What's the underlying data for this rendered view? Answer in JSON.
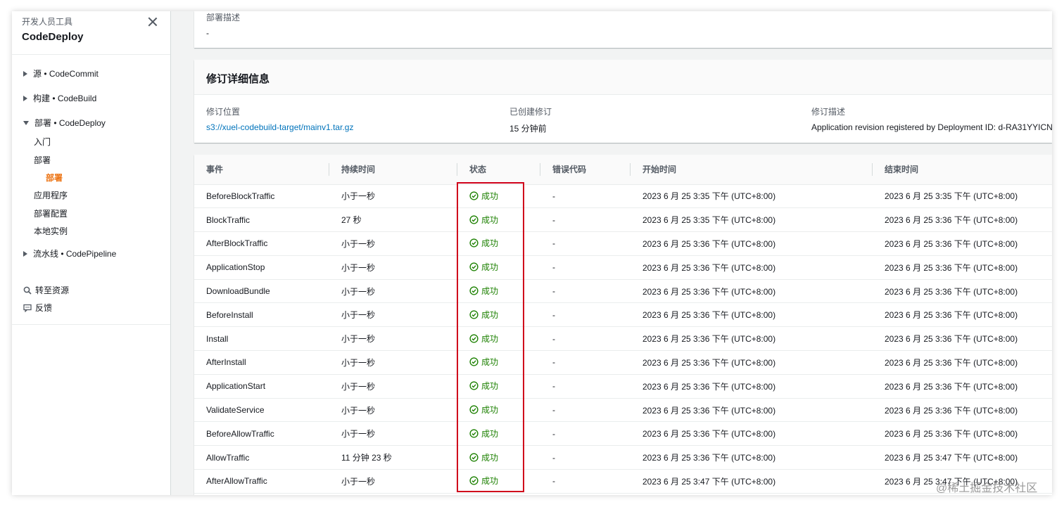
{
  "sidebar": {
    "subtitle": "开发人员工具",
    "title": "CodeDeploy",
    "groups": [
      {
        "label": "源 • CodeCommit"
      },
      {
        "label": "构建 • CodeBuild"
      },
      {
        "label": "部署 • CodeDeploy"
      },
      {
        "label": "流水线 • CodePipeline"
      }
    ],
    "deploy_items": [
      {
        "label": "入门"
      },
      {
        "label": "部署"
      },
      {
        "label": "部署"
      },
      {
        "label": "应用程序"
      },
      {
        "label": "部署配置"
      },
      {
        "label": "本地实例"
      }
    ],
    "utils": [
      {
        "label": "转至资源",
        "icon": "search-icon"
      },
      {
        "label": "反馈",
        "icon": "feedback-icon"
      }
    ],
    "accent_color": "#ec7211"
  },
  "deployment": {
    "description_label": "部署描述",
    "description_value": "-"
  },
  "revision": {
    "heading": "修订详细信息",
    "location_label": "修订位置",
    "location_value": "s3://xuel-codebuild-target/mainv1.tar.gz",
    "created_label": "已创建修订",
    "created_value": "15 分钟前",
    "desc_label": "修订描述",
    "desc_value": "Application revision registered by Deployment ID: d-RA31YYICN"
  },
  "events_table": {
    "columns": [
      "事件",
      "持续时间",
      "状态",
      "错误代码",
      "开始时间",
      "结束时间"
    ],
    "status_color": "#1d8102",
    "rows": [
      {
        "event": "BeforeBlockTraffic",
        "duration": "小于一秒",
        "status": "成功",
        "error": "-",
        "start": "2023 6 月 25 3:35 下午 (UTC+8:00)",
        "end": "2023 6 月 25 3:35 下午 (UTC+8:00)"
      },
      {
        "event": "BlockTraffic",
        "duration": "27 秒",
        "status": "成功",
        "error": "-",
        "start": "2023 6 月 25 3:35 下午 (UTC+8:00)",
        "end": "2023 6 月 25 3:36 下午 (UTC+8:00)"
      },
      {
        "event": "AfterBlockTraffic",
        "duration": "小于一秒",
        "status": "成功",
        "error": "-",
        "start": "2023 6 月 25 3:36 下午 (UTC+8:00)",
        "end": "2023 6 月 25 3:36 下午 (UTC+8:00)"
      },
      {
        "event": "ApplicationStop",
        "duration": "小于一秒",
        "status": "成功",
        "error": "-",
        "start": "2023 6 月 25 3:36 下午 (UTC+8:00)",
        "end": "2023 6 月 25 3:36 下午 (UTC+8:00)"
      },
      {
        "event": "DownloadBundle",
        "duration": "小于一秒",
        "status": "成功",
        "error": "-",
        "start": "2023 6 月 25 3:36 下午 (UTC+8:00)",
        "end": "2023 6 月 25 3:36 下午 (UTC+8:00)"
      },
      {
        "event": "BeforeInstall",
        "duration": "小于一秒",
        "status": "成功",
        "error": "-",
        "start": "2023 6 月 25 3:36 下午 (UTC+8:00)",
        "end": "2023 6 月 25 3:36 下午 (UTC+8:00)"
      },
      {
        "event": "Install",
        "duration": "小于一秒",
        "status": "成功",
        "error": "-",
        "start": "2023 6 月 25 3:36 下午 (UTC+8:00)",
        "end": "2023 6 月 25 3:36 下午 (UTC+8:00)"
      },
      {
        "event": "AfterInstall",
        "duration": "小于一秒",
        "status": "成功",
        "error": "-",
        "start": "2023 6 月 25 3:36 下午 (UTC+8:00)",
        "end": "2023 6 月 25 3:36 下午 (UTC+8:00)"
      },
      {
        "event": "ApplicationStart",
        "duration": "小于一秒",
        "status": "成功",
        "error": "-",
        "start": "2023 6 月 25 3:36 下午 (UTC+8:00)",
        "end": "2023 6 月 25 3:36 下午 (UTC+8:00)"
      },
      {
        "event": "ValidateService",
        "duration": "小于一秒",
        "status": "成功",
        "error": "-",
        "start": "2023 6 月 25 3:36 下午 (UTC+8:00)",
        "end": "2023 6 月 25 3:36 下午 (UTC+8:00)"
      },
      {
        "event": "BeforeAllowTraffic",
        "duration": "小于一秒",
        "status": "成功",
        "error": "-",
        "start": "2023 6 月 25 3:36 下午 (UTC+8:00)",
        "end": "2023 6 月 25 3:36 下午 (UTC+8:00)"
      },
      {
        "event": "AllowTraffic",
        "duration": "11 分钟 23 秒",
        "status": "成功",
        "error": "-",
        "start": "2023 6 月 25 3:36 下午 (UTC+8:00)",
        "end": "2023 6 月 25 3:47 下午 (UTC+8:00)"
      },
      {
        "event": "AfterAllowTraffic",
        "duration": "小于一秒",
        "status": "成功",
        "error": "-",
        "start": "2023 6 月 25 3:47 下午 (UTC+8:00)",
        "end": "2023 6 月 25 3:47 下午 (UTC+8:00)"
      }
    ]
  },
  "watermark": "@稀土掘金技术社区",
  "highlight_color": "#d0021b"
}
